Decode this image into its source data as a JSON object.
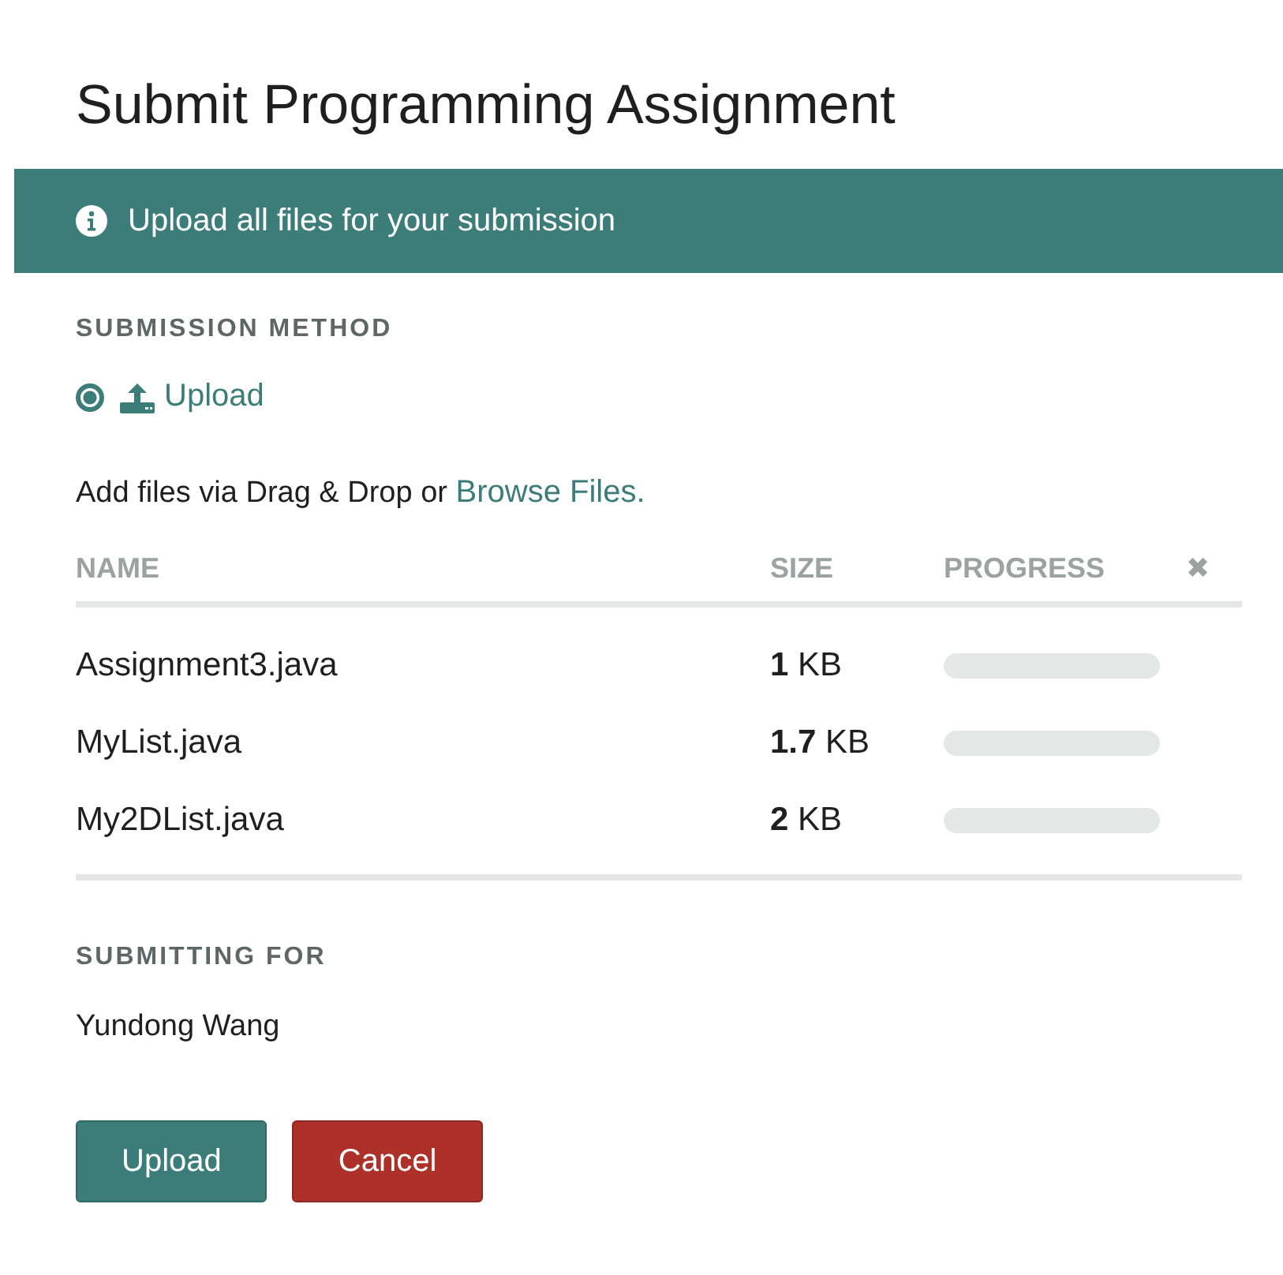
{
  "title": "Submit Programming Assignment",
  "banner": {
    "text": "Upload all files for your submission"
  },
  "submission_method": {
    "heading": "SUBMISSION METHOD",
    "options": [
      {
        "label": "Upload",
        "selected": true
      }
    ]
  },
  "add_files": {
    "text": "Add files via Drag & Drop or",
    "link": "Browse Files."
  },
  "table": {
    "columns": [
      "NAME",
      "SIZE",
      "PROGRESS"
    ],
    "clear_icon": "✖",
    "rows": [
      {
        "name": "Assignment3.java",
        "size": "**1** KB",
        "level": 0
      },
      {
        "name": "MyList.java",
        "size": "**1.7** KB",
        "level": 0
      },
      {
        "name": "My2DList.java",
        "size": "**2** KB",
        "level": 0
      }
    ]
  },
  "submitting_for": {
    "heading": "SUBMITTING FOR",
    "name": "Yundong Wang"
  },
  "buttons": [
    {
      "label": "Upload",
      "kind": "primary"
    },
    {
      "label": "Cancel",
      "kind": "danger"
    }
  ]
}
